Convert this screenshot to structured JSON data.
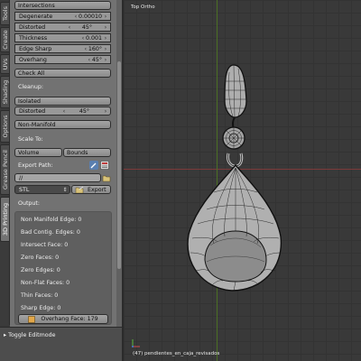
{
  "tabs": [
    "Tools",
    "Create",
    "UVs",
    "Shading",
    "Options",
    "Grease Pencil",
    "3D Printing"
  ],
  "panel": {
    "intersections_button": "Intersections",
    "degenerate": {
      "label": "Degenerate",
      "value": "0.00010"
    },
    "distorted": {
      "label": "Distorted",
      "value": "45°"
    },
    "thickness": {
      "label": "Thickness",
      "value": "0.001"
    },
    "edge_sharp": {
      "label": "Edge Sharp",
      "value": "160°"
    },
    "overhang": {
      "label": "Overhang",
      "value": "45°"
    },
    "check_all": "Check All",
    "cleanup_label": "Cleanup:",
    "isolated": "Isolated",
    "cleanup_distorted": {
      "label": "Distorted",
      "value": "45°"
    },
    "non_manifold": "Non-Manifold",
    "scale_to_label": "Scale To:",
    "volume": "Volume",
    "bounds": "Bounds",
    "export_path_label": "Export Path:",
    "export_path_value": "//",
    "format": "STL",
    "export": "Export",
    "output_label": "Output:",
    "output_lines": [
      "Non Manifold Edge: 0",
      "Bad Contig. Edges: 0",
      "Intersect Face: 0",
      "Zero Faces: 0",
      "Zero Edges: 0",
      "Non-Flat Faces: 0",
      "Thin Faces: 0",
      "Sharp Edge: 0"
    ],
    "overhang_face": "Overhang Face: 179",
    "toggle_editmode": "Toggle Editmode"
  },
  "viewport": {
    "view_label": "Top Ortho",
    "object_info": "(47) pendientes_en_caja_revisados"
  }
}
